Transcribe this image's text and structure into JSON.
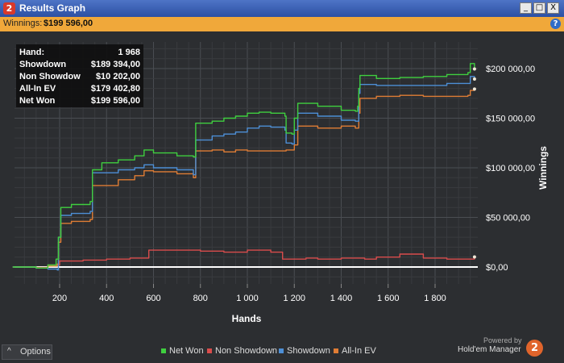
{
  "window": {
    "title": "Results Graph",
    "app_badge": "2"
  },
  "window_buttons": {
    "minimize": "_",
    "maximize": "□",
    "close": "X"
  },
  "infobar": {
    "label": "Winnings:",
    "value": "$199 596,00",
    "help": "?"
  },
  "stats": [
    {
      "key": "Hand:",
      "value": "1 968"
    },
    {
      "key": "Showdown",
      "value": "$189 394,00"
    },
    {
      "key": "Non Showdow",
      "value": "$10 202,00"
    },
    {
      "key": "All-In EV",
      "value": "$179 402,80"
    },
    {
      "key": "Net Won",
      "value": "$199 596,00"
    }
  ],
  "options": {
    "caret": "^",
    "label": "Options"
  },
  "powered": {
    "line1": "Powered by",
    "line2": "Hold'em Manager",
    "badge": "2"
  },
  "chart_data": {
    "type": "line",
    "xlabel": "Hands",
    "ylabel": "Winnings",
    "xlim": [
      0,
      1968
    ],
    "ylim": [
      -12000,
      222000
    ],
    "x_ticks": [
      200,
      400,
      600,
      800,
      1000,
      1200,
      1400,
      1600,
      1800
    ],
    "x_tick_labels": [
      "200",
      "400",
      "600",
      "800",
      "1 000",
      "1 200",
      "1 400",
      "1 600",
      "1 800"
    ],
    "y_ticks": [
      0,
      50000,
      100000,
      150000,
      200000
    ],
    "y_tick_labels": [
      "$0,00",
      "$50 000,00",
      "$100 000,00",
      "$150 000,00",
      "$200 000,00"
    ],
    "grid": true,
    "legend_position": "bottom-center",
    "series": [
      {
        "name": "Net Won",
        "color": "#3fcf3f",
        "points": [
          [
            0,
            0
          ],
          [
            100,
            -1000
          ],
          [
            150,
            2000
          ],
          [
            185,
            8000
          ],
          [
            195,
            30000
          ],
          [
            205,
            60000
          ],
          [
            250,
            63000
          ],
          [
            330,
            66000
          ],
          [
            340,
            98000
          ],
          [
            380,
            105000
          ],
          [
            450,
            108000
          ],
          [
            520,
            112000
          ],
          [
            560,
            118000
          ],
          [
            600,
            115000
          ],
          [
            700,
            112000
          ],
          [
            770,
            111000
          ],
          [
            780,
            145000
          ],
          [
            850,
            147000
          ],
          [
            900,
            150000
          ],
          [
            950,
            152000
          ],
          [
            1000,
            155000
          ],
          [
            1050,
            156000
          ],
          [
            1100,
            155000
          ],
          [
            1160,
            152000
          ],
          [
            1165,
            135000
          ],
          [
            1190,
            134000
          ],
          [
            1200,
            150000
          ],
          [
            1215,
            165000
          ],
          [
            1300,
            162000
          ],
          [
            1400,
            158000
          ],
          [
            1460,
            157000
          ],
          [
            1470,
            162000
          ],
          [
            1475,
            180000
          ],
          [
            1480,
            193000
          ],
          [
            1550,
            190000
          ],
          [
            1650,
            191000
          ],
          [
            1750,
            192000
          ],
          [
            1850,
            194000
          ],
          [
            1940,
            196000
          ],
          [
            1950,
            205000
          ],
          [
            1968,
            199596
          ]
        ]
      },
      {
        "name": "Non Showdown",
        "color": "#d94c4c",
        "points": [
          [
            0,
            0
          ],
          [
            100,
            -500
          ],
          [
            150,
            2000
          ],
          [
            200,
            6000
          ],
          [
            300,
            7000
          ],
          [
            400,
            8000
          ],
          [
            500,
            9000
          ],
          [
            580,
            17000
          ],
          [
            700,
            17000
          ],
          [
            800,
            16000
          ],
          [
            900,
            15000
          ],
          [
            1000,
            17000
          ],
          [
            1100,
            15000
          ],
          [
            1150,
            8000
          ],
          [
            1250,
            9000
          ],
          [
            1300,
            8000
          ],
          [
            1400,
            9000
          ],
          [
            1500,
            8000
          ],
          [
            1550,
            10000
          ],
          [
            1650,
            13000
          ],
          [
            1750,
            9000
          ],
          [
            1850,
            8000
          ],
          [
            1968,
            10202
          ]
        ]
      },
      {
        "name": "Showdown",
        "color": "#4d8fd6",
        "points": [
          [
            0,
            0
          ],
          [
            100,
            -1000
          ],
          [
            150,
            -2000
          ],
          [
            190,
            -3000
          ],
          [
            195,
            30000
          ],
          [
            205,
            52000
          ],
          [
            250,
            54000
          ],
          [
            330,
            56000
          ],
          [
            340,
            95000
          ],
          [
            450,
            98000
          ],
          [
            520,
            100000
          ],
          [
            560,
            103000
          ],
          [
            600,
            100000
          ],
          [
            700,
            98000
          ],
          [
            770,
            93000
          ],
          [
            780,
            128000
          ],
          [
            850,
            132000
          ],
          [
            900,
            134000
          ],
          [
            950,
            136000
          ],
          [
            1000,
            140000
          ],
          [
            1050,
            142000
          ],
          [
            1100,
            141000
          ],
          [
            1160,
            138000
          ],
          [
            1165,
            125000
          ],
          [
            1190,
            124000
          ],
          [
            1200,
            138000
          ],
          [
            1215,
            155000
          ],
          [
            1300,
            152000
          ],
          [
            1400,
            148000
          ],
          [
            1460,
            147000
          ],
          [
            1475,
            175000
          ],
          [
            1480,
            184000
          ],
          [
            1550,
            183000
          ],
          [
            1650,
            183000
          ],
          [
            1750,
            183000
          ],
          [
            1850,
            185000
          ],
          [
            1940,
            185000
          ],
          [
            1950,
            192000
          ],
          [
            1968,
            189394
          ]
        ]
      },
      {
        "name": "All-In EV",
        "color": "#e07d35",
        "points": [
          [
            0,
            0
          ],
          [
            100,
            -1000
          ],
          [
            150,
            1000
          ],
          [
            190,
            3000
          ],
          [
            195,
            25000
          ],
          [
            205,
            44000
          ],
          [
            250,
            46000
          ],
          [
            330,
            48000
          ],
          [
            340,
            82000
          ],
          [
            450,
            88000
          ],
          [
            520,
            92000
          ],
          [
            560,
            97000
          ],
          [
            600,
            96000
          ],
          [
            700,
            94000
          ],
          [
            770,
            90000
          ],
          [
            780,
            117000
          ],
          [
            850,
            118000
          ],
          [
            900,
            116000
          ],
          [
            950,
            118000
          ],
          [
            1000,
            117000
          ],
          [
            1050,
            117000
          ],
          [
            1100,
            117000
          ],
          [
            1160,
            117000
          ],
          [
            1165,
            118000
          ],
          [
            1200,
            123000
          ],
          [
            1215,
            142000
          ],
          [
            1300,
            140000
          ],
          [
            1400,
            142000
          ],
          [
            1460,
            140000
          ],
          [
            1475,
            155000
          ],
          [
            1480,
            170000
          ],
          [
            1550,
            172000
          ],
          [
            1650,
            173000
          ],
          [
            1750,
            172000
          ],
          [
            1850,
            172000
          ],
          [
            1940,
            173000
          ],
          [
            1950,
            178000
          ],
          [
            1968,
            179402.8
          ]
        ]
      }
    ]
  }
}
